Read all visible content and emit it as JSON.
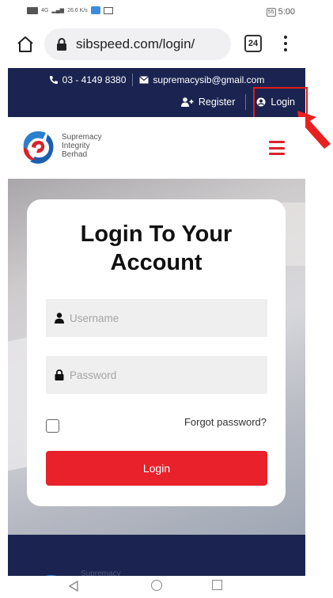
{
  "status_bar": {
    "signal_text": "4G",
    "speed": "26.6",
    "speed_unit": "K/s",
    "battery": "55",
    "time": "5:00"
  },
  "browser": {
    "url": "sibspeed.com/login/",
    "tab_count": "24"
  },
  "topbar": {
    "phone": "03 - 4149 8380",
    "email": "supremacysib@gmail.com",
    "register_label": "Register",
    "login_label": "Login"
  },
  "logo": {
    "line1": "Supremacy",
    "line2": "Integrity",
    "line3": "Berhad"
  },
  "login_form": {
    "title_line1": "Login To Your",
    "title_line2": "Account",
    "username_placeholder": "Username",
    "password_placeholder": "Password",
    "forgot_label": "Forgot password?",
    "submit_label": "Login"
  },
  "footer": {
    "brand": "Supremacy"
  },
  "colors": {
    "navy": "#1b2450",
    "accent_red": "#e8212b",
    "highlight_red": "#e21b1b"
  }
}
